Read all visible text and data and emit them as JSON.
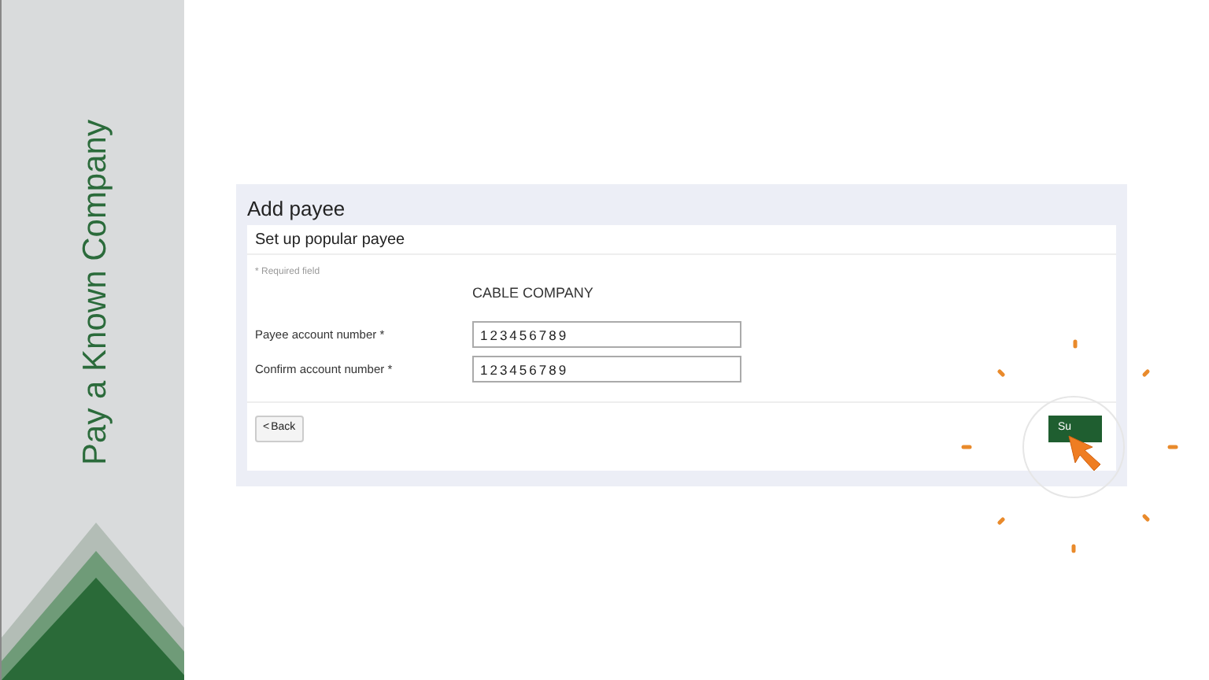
{
  "sidebar": {
    "title": "Pay a Known Company"
  },
  "panel": {
    "title": "Add payee",
    "subtitle": "Set up popular payee",
    "required_note": "* Required field",
    "payee_name": "CABLE COMPANY",
    "fields": [
      {
        "label": "Payee account number *",
        "value": "123456789"
      },
      {
        "label": "Confirm account number *",
        "value": "123456789"
      }
    ],
    "back_button": {
      "icon": "<",
      "label": "Back"
    },
    "submit_button": {
      "label": "Su"
    }
  }
}
